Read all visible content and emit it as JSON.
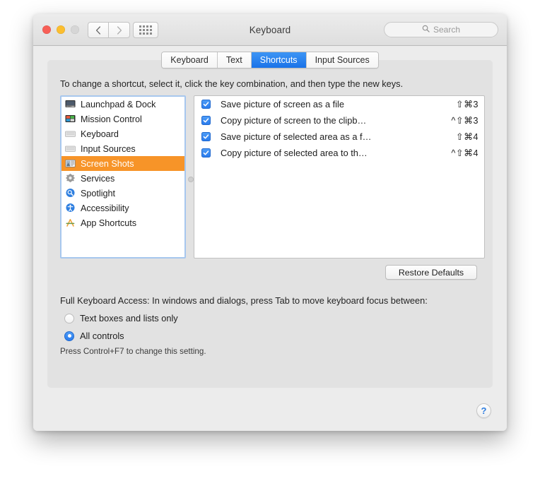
{
  "window": {
    "title": "Keyboard",
    "traffic_lights": [
      "close-red",
      "minimize-yellow",
      "zoom-disabled"
    ],
    "nav": {
      "back_icon": "chevron-left-icon",
      "forward_icon": "chevron-right-icon",
      "grid_icon": "show-all-grid-icon"
    }
  },
  "search": {
    "placeholder": "Search",
    "icon": "search-icon"
  },
  "tabs": [
    {
      "label": "Keyboard",
      "active": false
    },
    {
      "label": "Text",
      "active": false
    },
    {
      "label": "Shortcuts",
      "active": true
    },
    {
      "label": "Input Sources",
      "active": false
    }
  ],
  "hint": "To change a shortcut, select it, click the key combination, and then type the new keys.",
  "sidebar": {
    "items": [
      {
        "label": "Launchpad & Dock",
        "icon": "launchpad-dock-icon",
        "selected": false
      },
      {
        "label": "Mission Control",
        "icon": "mission-control-icon",
        "selected": false
      },
      {
        "label": "Keyboard",
        "icon": "keyboard-icon",
        "selected": false
      },
      {
        "label": "Input Sources",
        "icon": "input-sources-icon",
        "selected": false
      },
      {
        "label": "Screen Shots",
        "icon": "screen-shots-icon",
        "selected": true
      },
      {
        "label": "Services",
        "icon": "services-gear-icon",
        "selected": false
      },
      {
        "label": "Spotlight",
        "icon": "spotlight-icon",
        "selected": false
      },
      {
        "label": "Accessibility",
        "icon": "accessibility-icon",
        "selected": false
      },
      {
        "label": "App Shortcuts",
        "icon": "app-shortcuts-icon",
        "selected": false
      }
    ]
  },
  "shortcuts": [
    {
      "checked": true,
      "name": "Save picture of screen as a file",
      "keys": "⇧⌘3"
    },
    {
      "checked": true,
      "name": "Copy picture of screen to the clipb…",
      "keys": "^⇧⌘3"
    },
    {
      "checked": true,
      "name": "Save picture of selected area as a f…",
      "keys": "⇧⌘4"
    },
    {
      "checked": true,
      "name": "Copy picture of selected area to th…",
      "keys": "^⇧⌘4"
    }
  ],
  "restore_defaults_label": "Restore Defaults",
  "full_keyboard_access": {
    "title": "Full Keyboard Access: In windows and dialogs, press Tab to move keyboard focus between:",
    "options": [
      {
        "label": "Text boxes and lists only",
        "selected": false
      },
      {
        "label": "All controls",
        "selected": true
      }
    ],
    "footnote": "Press Control+F7 to change this setting."
  },
  "help_label": "?",
  "colors": {
    "selection_orange": "#f79428",
    "accent_blue": "#2b7ced",
    "window_bg": "#ececec",
    "panel_bg": "#e2e2e2"
  }
}
